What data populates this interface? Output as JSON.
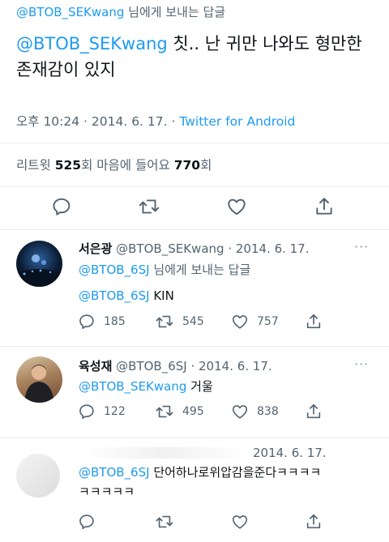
{
  "main_tweet": {
    "reply_handle": "@BTOB_SEKwang",
    "reply_suffix": " 님에게 보내는 답글",
    "mention": "@BTOB_SEKwang",
    "body_rest": " 칫..  난 귀만 나와도 형만한 존재감이 있지",
    "time": "오후 10:24 · 2014. 6. 17. · ",
    "source": "Twitter for Android",
    "retweet_label": "리트윗 ",
    "retweet_count": "525",
    "retweet_unit": "회",
    "like_label": " 마음에 들어요 ",
    "like_count": "770",
    "like_unit": "회"
  },
  "replies": [
    {
      "name": "서은광",
      "handle_date": " @BTOB_SEKwang · 2014. 6. 17.",
      "reply_handle": "@BTOB_6SJ",
      "reply_suffix": " 님에게 보내는 답글",
      "mention": "@BTOB_6SJ",
      "text": " KIN",
      "replies": "185",
      "retweets": "545",
      "likes": "757"
    },
    {
      "name": "육성재",
      "handle_date": " @BTOB_6SJ · 2014. 6. 17.",
      "mention": "@BTOB_SEKwang",
      "text": " 거울",
      "replies": "122",
      "retweets": "495",
      "likes": "838"
    },
    {
      "date": "2014. 6. 17.",
      "mention": "@BTOB_6SJ",
      "text": " 단어하나로위압감을준다ㅋㅋㅋㅋ",
      "text2": "ㅋㅋㅋㅋㅋ"
    }
  ],
  "icons": {
    "reply": "speech-bubble-icon",
    "retweet": "retweet-arrows-icon",
    "like": "heart-icon",
    "share": "share-upload-icon",
    "more": "more-dots-icon"
  },
  "colors": {
    "accent": "#1d9bf0",
    "muted": "#536471",
    "text": "#0f1419"
  }
}
